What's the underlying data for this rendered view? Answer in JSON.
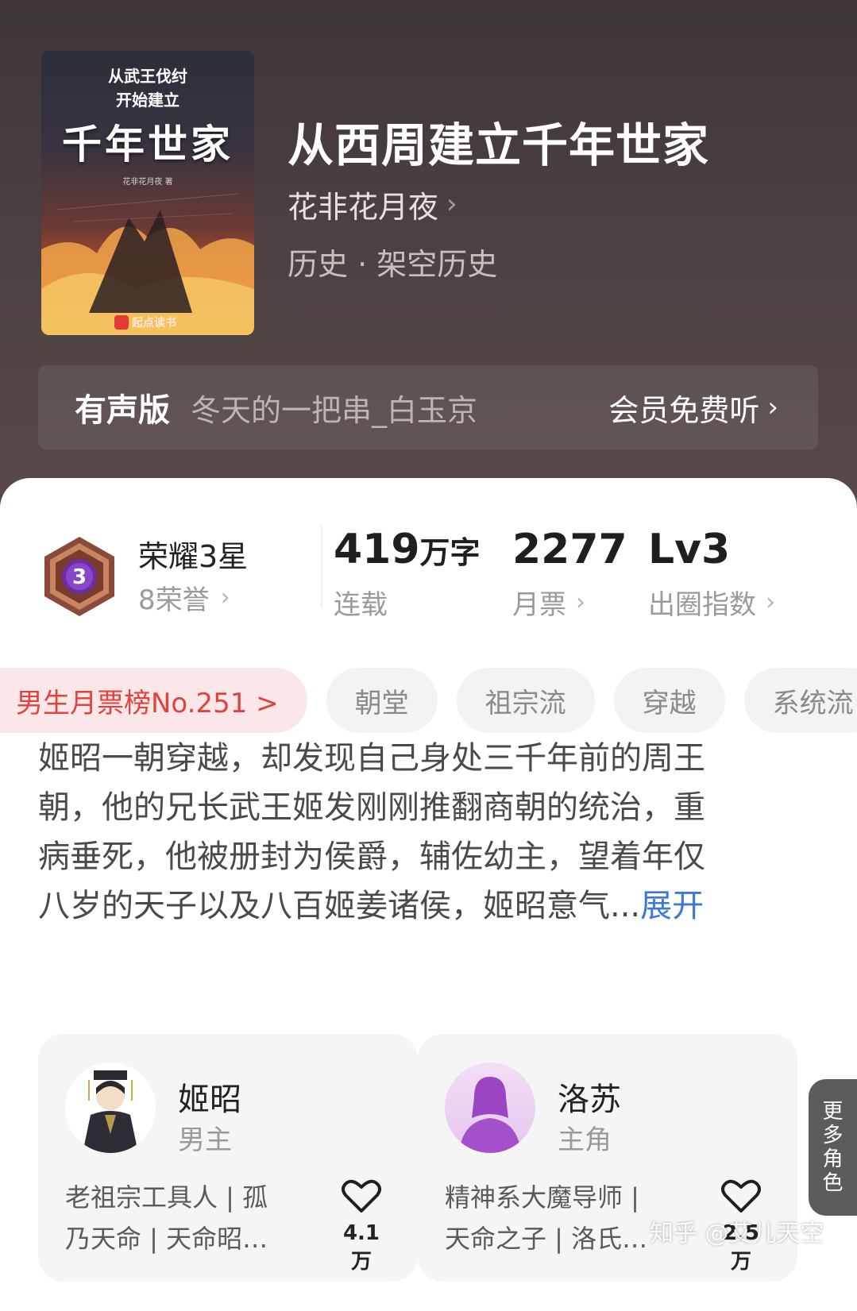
{
  "book": {
    "cover_line1": "从武王伐纣",
    "cover_line2": "开始建立",
    "cover_big": "千年世家",
    "cover_author": "花非花月夜 著",
    "cover_publisher": "起点读书",
    "title": "从西周建立千年世家",
    "author": "花非花月夜",
    "genre": "历史 · 架空历史"
  },
  "audio": {
    "label": "有声版",
    "narrator": "冬天的一把串_白玉京",
    "cta": "会员免费听"
  },
  "honor": {
    "badge_level": "3",
    "title": "荣耀3星",
    "sub": "8荣誉"
  },
  "stats": {
    "words_value": "419",
    "words_unit": "万字",
    "words_label": "连载",
    "tickets_value": "2277",
    "tickets_label": "月票",
    "index_value": "Lv3",
    "index_label": "出圈指数"
  },
  "tags": {
    "rank": "男生月票榜No.251 >",
    "items": [
      "朝堂",
      "祖宗流",
      "穿越",
      "系统流"
    ]
  },
  "description": {
    "lines": [
      "姬昭一朝穿越，却发现自己身处三千年前的周王",
      "朝，他的兄长武王姬发刚刚推翻商朝的统治，重",
      "病垂死，他被册封为侯爵，辅佐幼主，望着年仅",
      "八岁的天子以及八百姬姜诸侯，姬昭意气..."
    ],
    "expand": "展开"
  },
  "characters": [
    {
      "name": "姬昭",
      "role": "男主",
      "tags_line1": "老祖宗工具人 | 孤",
      "tags_line2": "乃天命 | 天命昭…",
      "likes": "4.1万"
    },
    {
      "name": "洛苏",
      "role": "主角",
      "tags_line1": "精神系大魔导师 |",
      "tags_line2": "天命之子 | 洛氏…",
      "likes": "2.5万"
    }
  ],
  "more_roles": [
    "更",
    "多",
    "角",
    "色"
  ],
  "watermark": "知乎 @艾儿天空",
  "colors": {
    "header_bg": "#4c4043",
    "accent_red": "#e0433f",
    "link_blue": "#3b78d8"
  },
  "icons": [
    "chevron-right-icon",
    "honor-badge-icon",
    "heart-icon"
  ]
}
